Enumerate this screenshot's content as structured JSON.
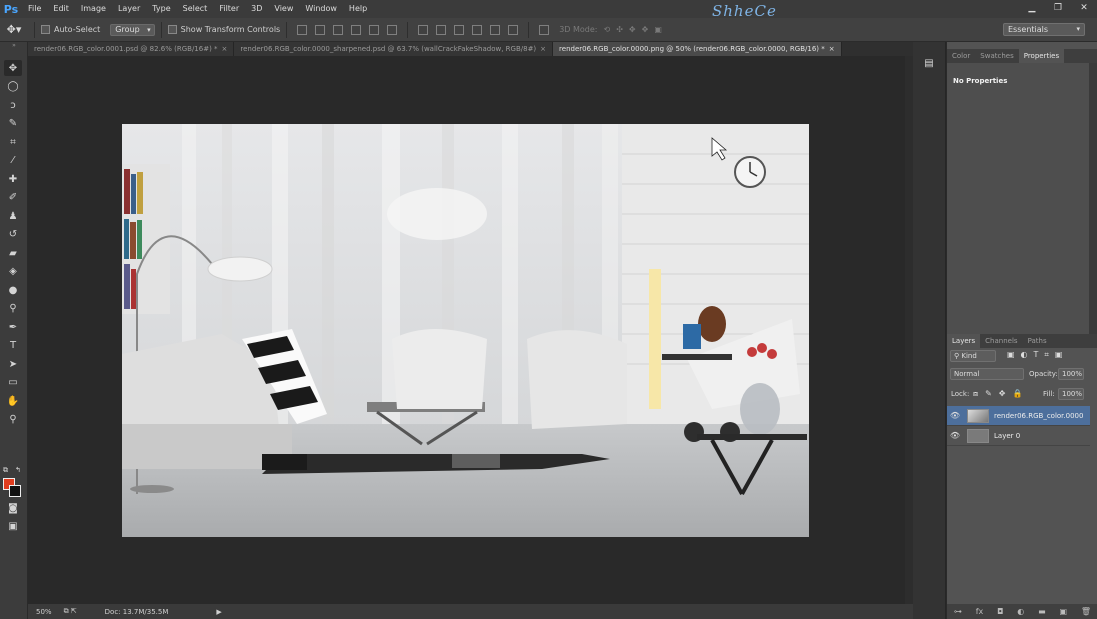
{
  "app": {
    "logo": "Ps",
    "watermark": "ShheCe"
  },
  "menu": [
    "File",
    "Edit",
    "Image",
    "Layer",
    "Type",
    "Select",
    "Filter",
    "3D",
    "View",
    "Window",
    "Help"
  ],
  "window_controls": {
    "minimize": "▁",
    "restore": "❐",
    "close": "✕"
  },
  "options_bar": {
    "auto_select_label": "Auto-Select",
    "auto_select_value": "Group",
    "show_transform_label": "Show Transform Controls",
    "mode_3d_label": "3D Mode:",
    "workspace": "Essentials"
  },
  "tabs": [
    {
      "label": "render06.RGB_color.0001.psd @ 82.6% (RGB/16#) *",
      "close": "×"
    },
    {
      "label": "render06.RGB_color.0000_sharpened.psd @ 63.7% (wallCrackFakeShadow, RGB/8#)",
      "close": "×"
    },
    {
      "label": "render06.RGB_color.0000.png @ 50% (render06.RGB_color.0000, RGB/16) *",
      "close": "×"
    }
  ],
  "tools": [
    {
      "name": "move-tool",
      "glyph": "✥"
    },
    {
      "name": "elliptical-marquee-tool",
      "glyph": "◯"
    },
    {
      "name": "lasso-tool",
      "glyph": "ↄ"
    },
    {
      "name": "quick-selection-tool",
      "glyph": "✎"
    },
    {
      "name": "crop-tool",
      "glyph": "⌗"
    },
    {
      "name": "eyedropper-tool",
      "glyph": "⁄"
    },
    {
      "name": "healing-brush-tool",
      "glyph": "✚"
    },
    {
      "name": "brush-tool",
      "glyph": "✐"
    },
    {
      "name": "clone-stamp-tool",
      "glyph": "♟"
    },
    {
      "name": "history-brush-tool",
      "glyph": "↺"
    },
    {
      "name": "eraser-tool",
      "glyph": "▰"
    },
    {
      "name": "paint-bucket-tool",
      "glyph": "◈"
    },
    {
      "name": "blur-tool",
      "glyph": "●"
    },
    {
      "name": "dodge-tool",
      "glyph": "⚲"
    },
    {
      "name": "pen-tool",
      "glyph": "✒"
    },
    {
      "name": "type-tool",
      "glyph": "T"
    },
    {
      "name": "path-selection-tool",
      "glyph": "➤"
    },
    {
      "name": "rectangle-tool",
      "glyph": "▭"
    },
    {
      "name": "hand-tool",
      "glyph": "✋"
    },
    {
      "name": "zoom-tool",
      "glyph": "⚲"
    }
  ],
  "colors": {
    "foreground": "#e03c1e",
    "background": "#111111"
  },
  "status": {
    "zoom": "50%",
    "doc": "Doc: 13.7M/35.5M"
  },
  "properties_panel": {
    "tabs": [
      "Color",
      "Swatches",
      "Properties"
    ],
    "active_tab": "Properties",
    "content": "No Properties"
  },
  "layers_panel": {
    "tabs": [
      "Layers",
      "Channels",
      "Paths"
    ],
    "filter": "Kind",
    "blend_mode": "Normal",
    "opacity_label": "Opacity:",
    "opacity": "100%",
    "lock_label": "Lock:",
    "fill_label": "Fill:",
    "fill": "100%",
    "layers": [
      {
        "name": "render06.RGB_color.0000",
        "visible": "👁",
        "active": true
      },
      {
        "name": "Layer 0",
        "visible": "👁",
        "active": false
      }
    ],
    "footer_icons": [
      "link-icon",
      "fx-icon",
      "mask-icon",
      "adjustment-icon",
      "group-icon",
      "new-layer-icon",
      "trash-icon"
    ],
    "footer_glyphs": [
      "⊶",
      "fx",
      "◘",
      "◐",
      "▬",
      "▣",
      "🗑"
    ]
  }
}
